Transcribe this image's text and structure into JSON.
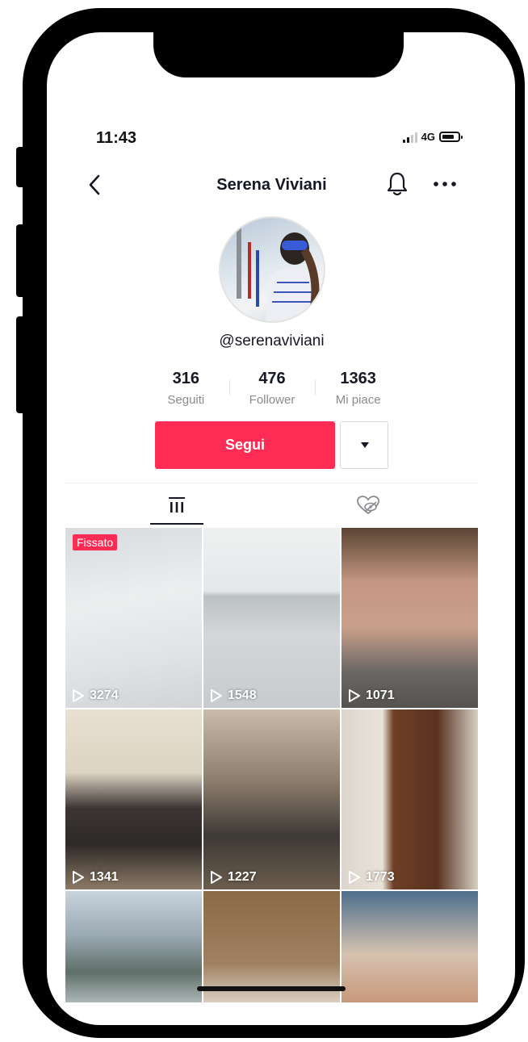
{
  "status_bar": {
    "time": "11:43",
    "network": "4G",
    "signal_bars": 2,
    "battery_level": 0.8
  },
  "header": {
    "title": "Serena Viviani",
    "back_icon": "chevron-left-icon",
    "bell_icon": "bell-icon",
    "more_icon": "ellipsis-icon"
  },
  "profile": {
    "avatar_icon": "profile-photo",
    "handle": "@serenaviviani",
    "stats": [
      {
        "value": "316",
        "label": "Seguiti"
      },
      {
        "value": "476",
        "label": "Follower"
      },
      {
        "value": "1363",
        "label": "Mi piace"
      }
    ],
    "follow_label": "Segui",
    "dropdown_icon": "caret-down-icon"
  },
  "tabs": [
    {
      "icon": "videos-grid-icon",
      "active": true
    },
    {
      "icon": "liked-hidden-icon",
      "active": false
    }
  ],
  "videos": [
    {
      "views": "3274",
      "badge": "Fissato"
    },
    {
      "views": "1548"
    },
    {
      "views": "1071"
    },
    {
      "views": "1341"
    },
    {
      "views": "1227"
    },
    {
      "views": "1773"
    },
    {
      "views": ""
    },
    {
      "views": ""
    },
    {
      "views": ""
    }
  ],
  "colors": {
    "accent": "#fe2c55",
    "text": "#161823",
    "secondary_text": "#8a8b91"
  }
}
